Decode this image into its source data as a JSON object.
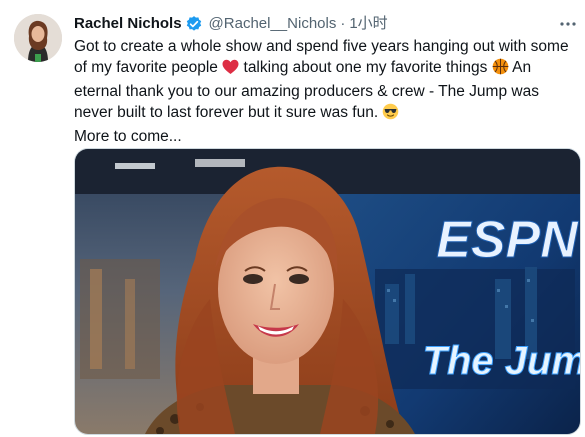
{
  "tweet": {
    "name": "Rachel Nichols",
    "handle": "@Rachel__Nichols",
    "separator": "·",
    "time": "1小时",
    "more_icon": "more-icon",
    "verified_icon": "verified-badge-icon",
    "text": {
      "line1a": "Got to  create a whole show and spend five years hanging out with some of my favorite people ",
      "line1b": " talking about one my favorite things ",
      "line1c": " An eternal thank you  to our amazing producers & crew - The Jump was never built to last forever but it sure was fun. ",
      "line2": "More to come..."
    },
    "emojis": [
      "red-heart-icon",
      "basketball-icon",
      "sunglasses-face-icon"
    ],
    "media": {
      "logo_text": "ESPN",
      "show_text": "The Jump"
    }
  },
  "colors": {
    "verified": "#1d9bf0",
    "text": "#0f1419",
    "secondary": "#536471"
  }
}
